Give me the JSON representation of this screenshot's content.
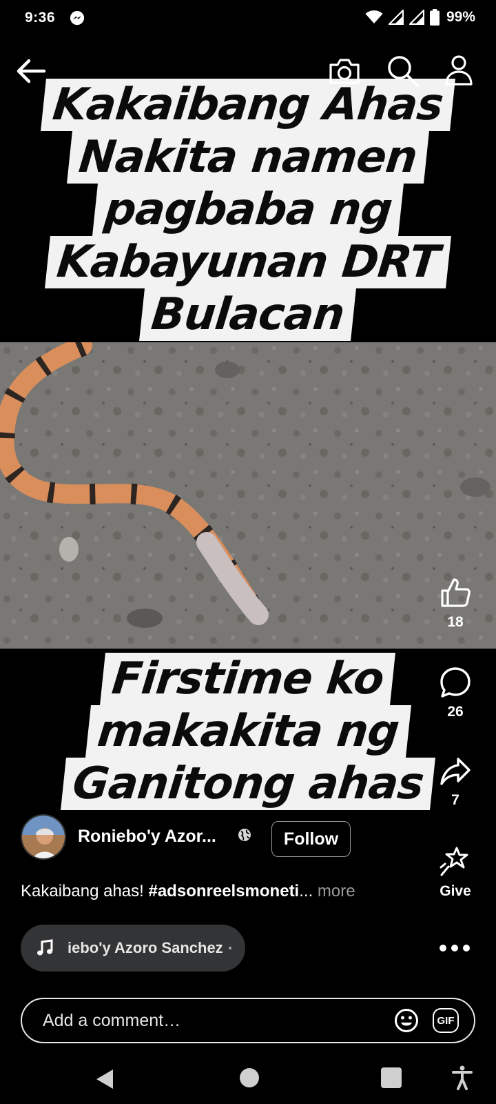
{
  "status_bar": {
    "time": "9:36",
    "battery": "99%"
  },
  "captions": {
    "top_lines": [
      "Kakaibang Ahas",
      "Nakita namen",
      "pagbaba ng",
      "Kabayunan DRT",
      "Bulacan"
    ],
    "bottom_lines": [
      "Firstime ko",
      "makakita ng",
      "Ganitong ahas"
    ]
  },
  "actions": {
    "likes": "18",
    "comments": "26",
    "shares": "7",
    "give_label": "Give"
  },
  "author": {
    "name": "Roniebo'y Azor...",
    "follow_label": "Follow"
  },
  "description": {
    "text": "Kakaibang ahas! ",
    "hashtag": "#adsonreelsmoneti",
    "ellipsis": "... ",
    "more_label": "more"
  },
  "audio": {
    "label": "iebo'y Azoro Sanchez"
  },
  "comment": {
    "placeholder": "Add a comment…",
    "gif_label": "GIF"
  },
  "colors": {
    "caption_bg": "#f2f2f2",
    "caption_text": "#0b0b0b",
    "pill_bg": "#333436"
  }
}
